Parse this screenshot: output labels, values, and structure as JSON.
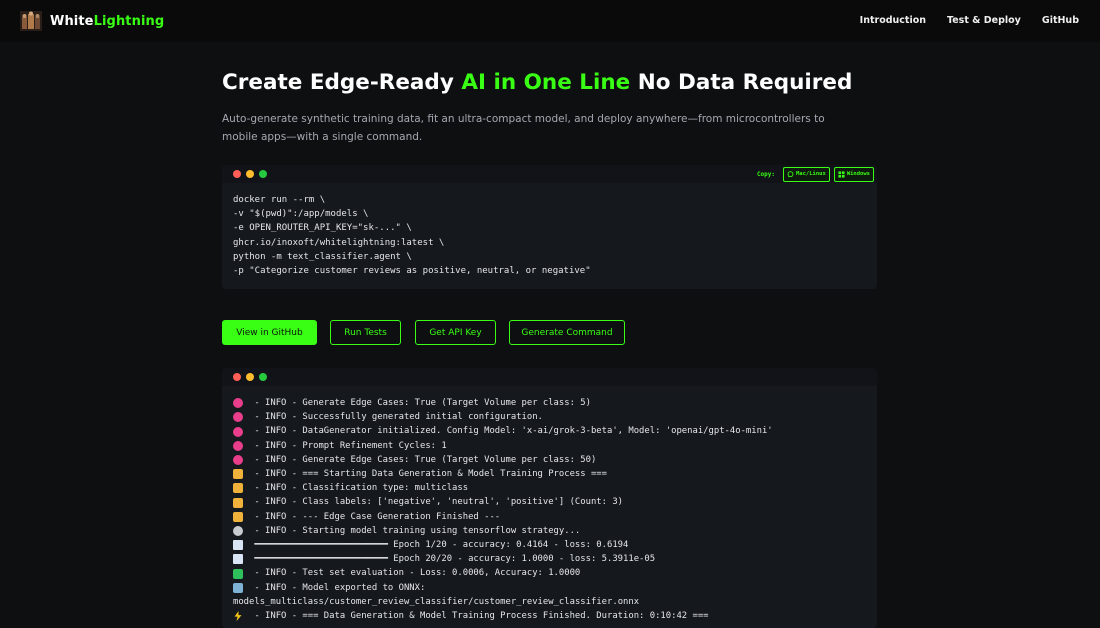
{
  "brand": {
    "name_part1": "White",
    "name_part2": "Lightning",
    "logo": "lightning-warriors-logo"
  },
  "nav": {
    "introduction": "Introduction",
    "test_deploy": "Test & Deploy",
    "github": "GitHub"
  },
  "hero": {
    "title_before": "Create Edge-Ready ",
    "title_accent": "AI in One Line",
    "title_after": " No Data Required",
    "subtitle": "Auto-generate synthetic training data, fit an ultra-compact model, and deploy anywhere—from microcontrollers to mobile apps—with a single command."
  },
  "command_terminal": {
    "copy_label": "Copy:",
    "mac_button": "Mac/Linux",
    "windows_button": "Windows",
    "lines": [
      "docker run --rm \\",
      "-v \"$(pwd)\":/app/models \\",
      "-e OPEN_ROUTER_API_KEY=\"sk-...\" \\",
      "ghcr.io/inoxoft/whitelightning:latest \\",
      "python -m text_classifier.agent \\",
      "-p \"Categorize customer reviews as positive, neutral, or negative\""
    ]
  },
  "buttons": {
    "view_github": "View in GitHub",
    "run_tests": "Run Tests",
    "get_api_key": "Get API Key",
    "generate_command": "Generate Command"
  },
  "colors": {
    "accent": "#39ff14",
    "background": "#0e0f11",
    "terminal": "#15181d"
  },
  "log_terminal": {
    "lines": [
      {
        "icon": "brain",
        "text": " - INFO - Generate Edge Cases: True (Target Volume per class: 5)"
      },
      {
        "icon": "brain",
        "text": " - INFO - Successfully generated initial configuration."
      },
      {
        "icon": "brain",
        "text": " - INFO - DataGenerator initialized. Config Model: 'x-ai/grok-3-beta', Model: 'openai/gpt-4o-mini'"
      },
      {
        "icon": "brain",
        "text": " - INFO - Prompt Refinement Cycles: 1"
      },
      {
        "icon": "brain",
        "text": " - INFO - Generate Edge Cases: True (Target Volume per class: 50)"
      },
      {
        "icon": "box",
        "text": " - INFO - === Starting Data Generation & Model Training Process ==="
      },
      {
        "icon": "box",
        "text": " - INFO - Classification type: multiclass"
      },
      {
        "icon": "box",
        "text": " - INFO - Class labels: ['negative', 'neutral', 'positive'] (Count: 3)"
      },
      {
        "icon": "box",
        "text": " - INFO - --- Edge Case Generation Finished ---"
      },
      {
        "icon": "gear",
        "text": " - INFO - Starting model training using tensorflow strategy..."
      },
      {
        "icon": "chart",
        "text": " ━━━━━━━━━━━━━━━━━━━━━━━━━ Epoch 1/20 - accuracy: 0.4164 - loss: 0.6194"
      },
      {
        "icon": "chart",
        "text": " ━━━━━━━━━━━━━━━━━━━━━━━━━ Epoch 20/20 - accuracy: 1.0000 - loss: 5.3911e-05"
      },
      {
        "icon": "check",
        "text": " - INFO - Test set evaluation - Loss: 0.0006, Accuracy: 1.0000"
      },
      {
        "icon": "robot",
        "text": " - INFO - Model exported to ONNX:"
      },
      {
        "icon": "",
        "text": "models_multiclass/customer_review_classifier/customer_review_classifier.onnx"
      },
      {
        "icon": "bolt",
        "text": " - INFO - === Data Generation & Model Training Process Finished. Duration: 0:10:42 ==="
      }
    ]
  }
}
